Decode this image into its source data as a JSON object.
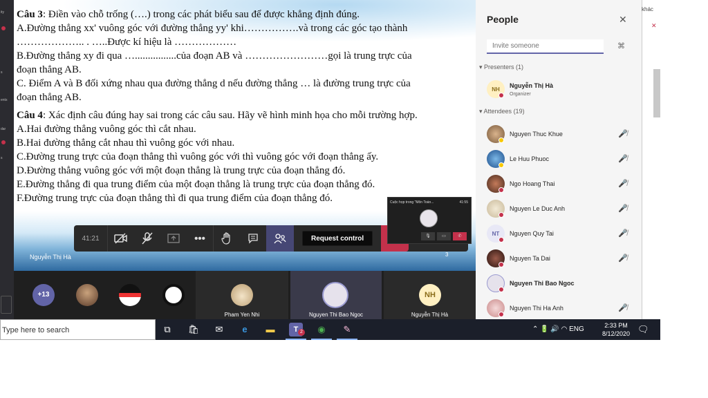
{
  "rail": {
    "labels": [
      "ity",
      "s",
      "ents",
      "dar",
      "s"
    ],
    "badge": "1"
  },
  "slide": {
    "cau3_label": "Câu 3",
    "cau3_text": ": Điền vào chỗ trống (….) trong các phát biểu sau để được khẳng định đúng.",
    "l1": "A.Đường thẳng xx' vuông góc với đường thẳng yy' khi…………….và trong các góc tạo thành",
    "l2": "……………….. . …..Được kí hiệu là ………………",
    "l3": "B.Đường thẳng xy đi qua …................của đoạn AB và ……………………gọi là trung trực của",
    "l4": "đoạn thẳng AB.",
    "l5": " C. Điểm A và B đối xứng nhau qua đường thẳng d nếu đường thẳng … là đường trung trực của",
    "l6": "đoạn thẳng AB.",
    "cau4_label": "Câu 4",
    "cau4_text": ":  Xác định câu đúng hay sai trong các câu sau. Hãy vẽ hình minh họa cho mỗi trường hợp.",
    "a": "A.Hai đường thẳng vuông góc thì cắt nhau.",
    "b": "B.Hai đường thẳng cắt nhau thì vuông góc với nhau.",
    "c": "C.Đường trung trực của đoạn thẳng thì vuông góc với thì vuông góc với đoạn thẳng ấy.",
    "d": "D.Đường thẳng vuông góc với một đoạn thẳng là trung trực của đoạn thẳng đó.",
    "e": "E.Đường thẳng đi qua trung điểm của một đoạn thẳng là trung trực của đoạn thẳng đó.",
    "f": "F.Đường trung trực của đoạn thẳng thì đi qua trung điểm của đoạn thẳng đó.",
    "presenter": "Nguyễn Thị Hà",
    "page": "3"
  },
  "callbar": {
    "timer": "41:21",
    "request_control": "Request control"
  },
  "mini": {
    "title": "Cuộc họp trong \"Môn Toán...",
    "time": "41:55"
  },
  "strip": {
    "more_count": "+13",
    "tiles": [
      {
        "name": "Pham Yen Nhi"
      },
      {
        "name": "Nguyen Thi Bao Ngoc"
      },
      {
        "name": "Nguyễn Thị Hà",
        "initials": "NH"
      }
    ]
  },
  "people": {
    "title": "People",
    "invite_placeholder": "Invite someone",
    "presenters_label": "Presenters (1)",
    "attendees_label": "Attendees (19)",
    "presenter": {
      "name": "Nguyễn Thị Hà",
      "role": "Organizer",
      "initials": "NH"
    },
    "attendees": [
      {
        "name": "Nguyen Thuc Khue"
      },
      {
        "name": "Le Huu Phuoc"
      },
      {
        "name": "Ngo Hoang Thai"
      },
      {
        "name": "Nguyen Le Duc Anh"
      },
      {
        "name": "Nguyen Quy Tai",
        "initials": "NT"
      },
      {
        "name": "Nguyen Ta Dai"
      },
      {
        "name": "Nguyen Thi Bao Ngoc"
      },
      {
        "name": "Nguyen Thi Ha Anh"
      }
    ]
  },
  "side": {
    "khac": "khác"
  },
  "taskbar": {
    "search": "Type here to search",
    "teams_badge": "2",
    "lang": "ENG",
    "time": "2:33 PM",
    "date": "8/12/2020"
  },
  "colors": {
    "teams_purple": "#6264a7",
    "hangup_red": "#c4314b",
    "panel_bg": "#f5f5f5",
    "strip_bg": "#1f1f1f"
  }
}
